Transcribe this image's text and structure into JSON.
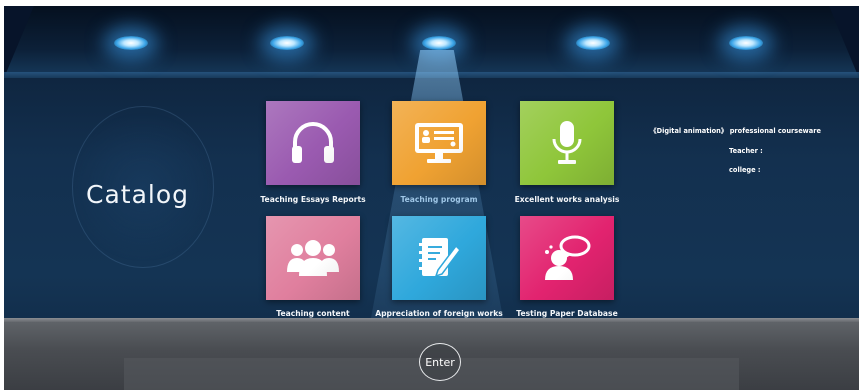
{
  "catalog": {
    "title": "Catalog"
  },
  "tiles": [
    {
      "label": "Teaching Essays Reports",
      "icon": "headphones-icon",
      "color": "#9a5ab0"
    },
    {
      "label": "Teaching program",
      "icon": "monitor-icon",
      "color": "#f0a232"
    },
    {
      "label": "Excellent works analysis",
      "icon": "microphone-icon",
      "color": "#8fc63a"
    },
    {
      "label": "Teaching content",
      "icon": "users-icon",
      "color": "#e07f9e"
    },
    {
      "label": "Appreciation of foreign works",
      "icon": "notebook-pen-icon",
      "color": "#2fa8dc"
    },
    {
      "label": "Testing Paper Database",
      "icon": "user-chat-icon",
      "color": "#e2236f"
    }
  ],
  "info": {
    "title": "《Digital animation》 professional courseware",
    "teacher": "Teacher :",
    "college": "college :"
  },
  "enter": {
    "label": "Enter"
  }
}
